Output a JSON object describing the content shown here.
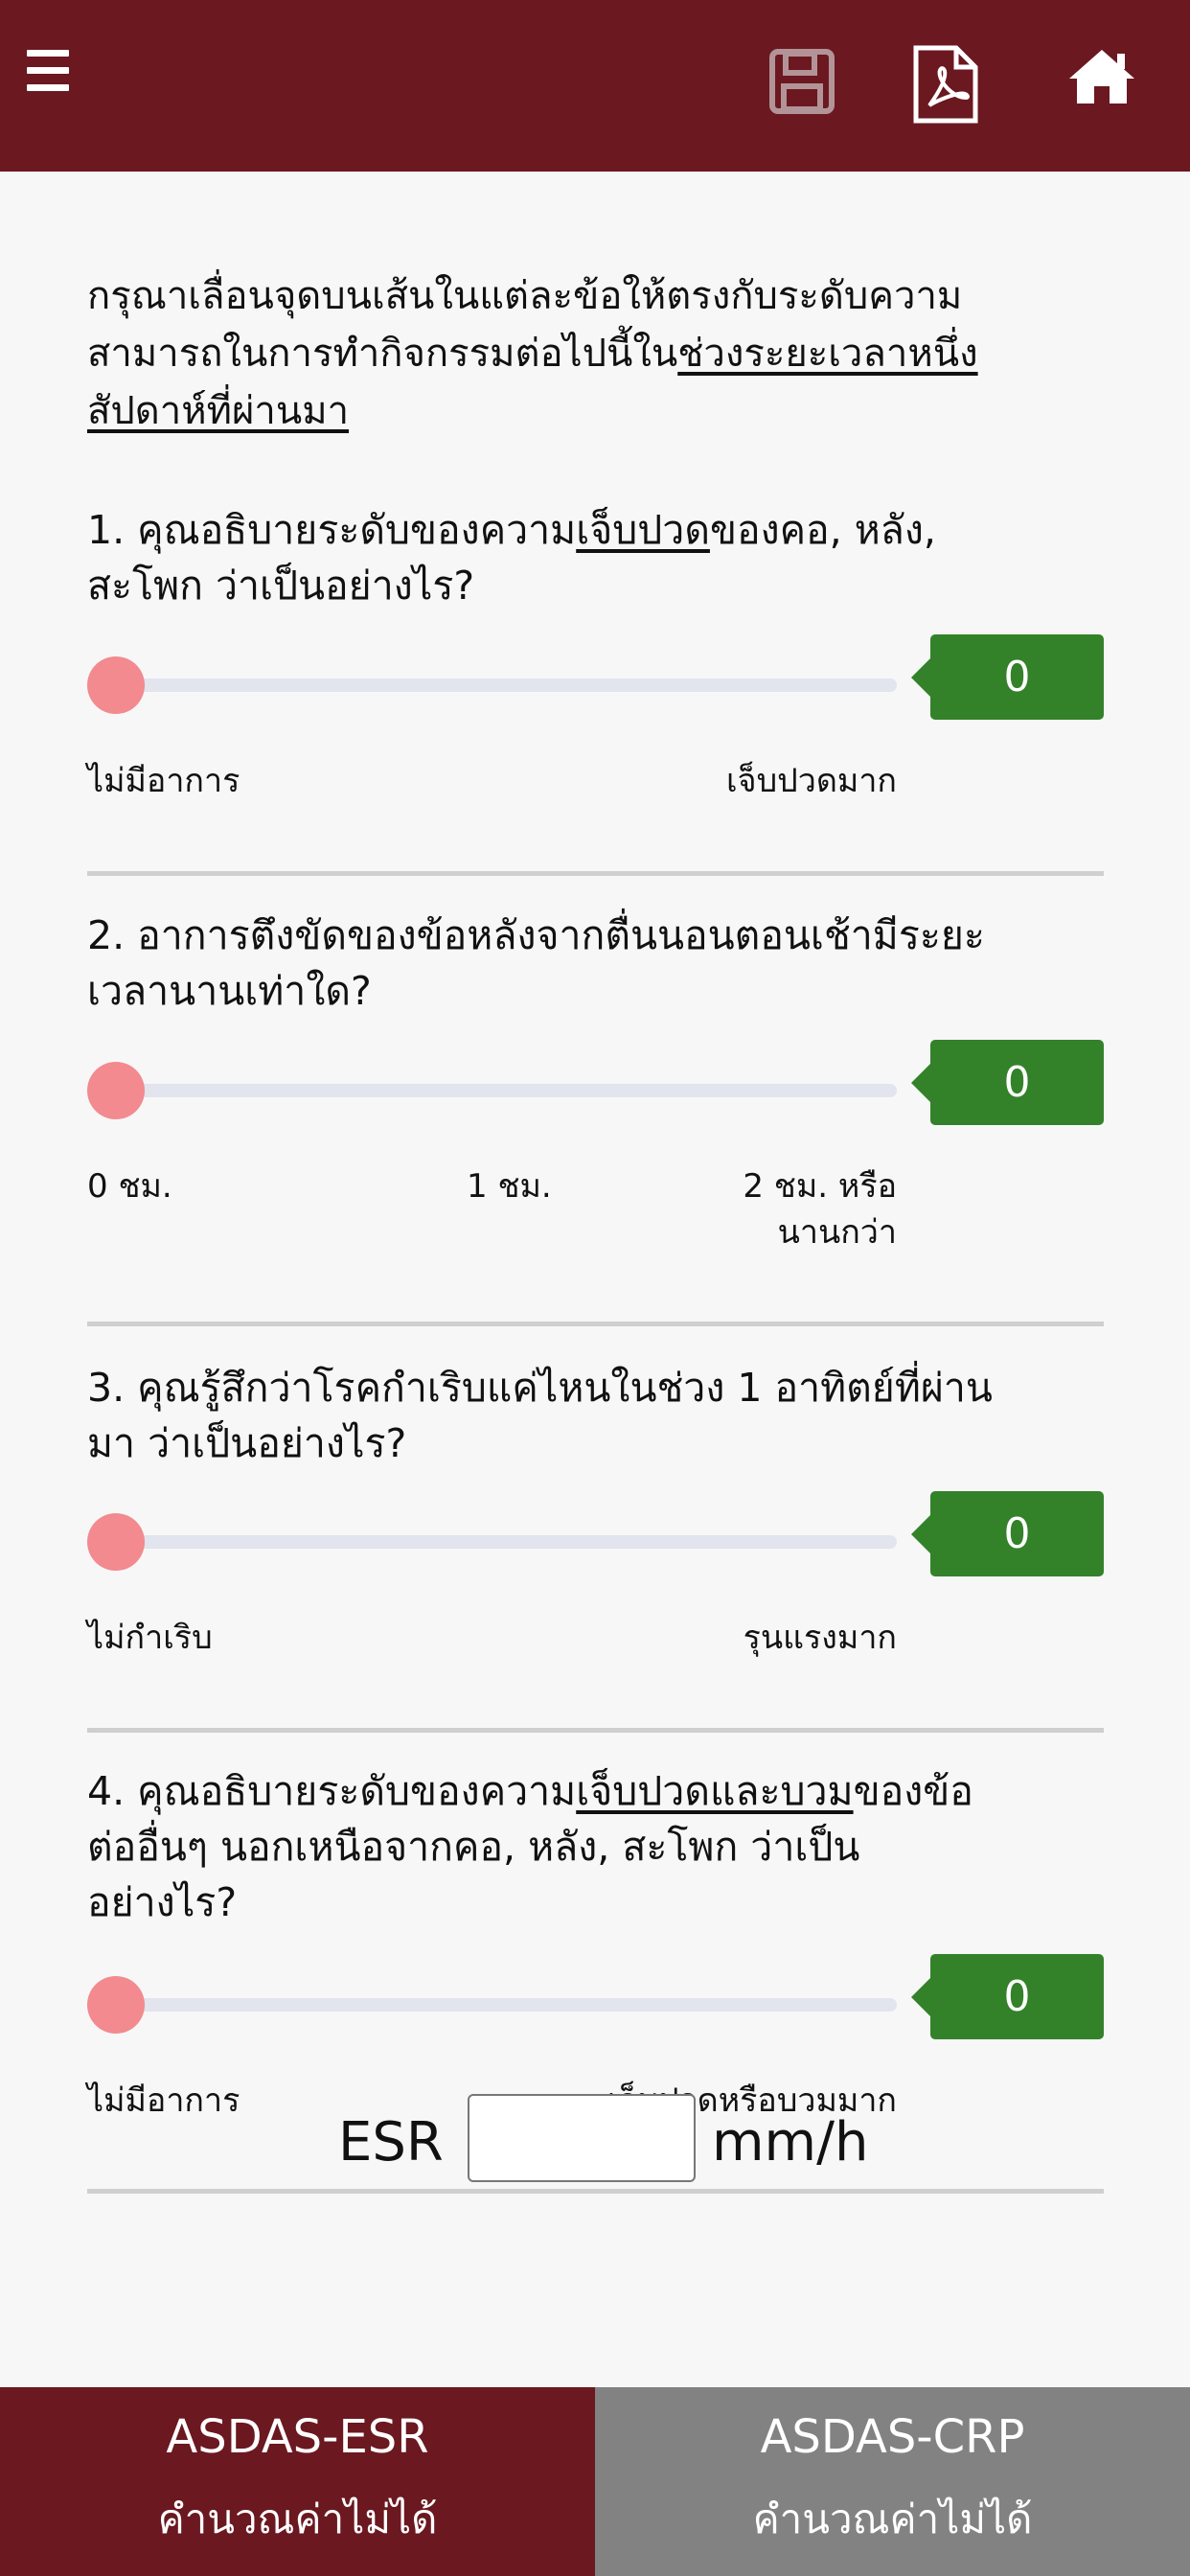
{
  "header": {
    "menu_icon": "hamburger-menu-icon",
    "save_icon": "floppy-disk-save-icon",
    "pdf_icon": "pdf-document-icon",
    "home_icon": "home-icon",
    "bar_color": "#6b1820"
  },
  "intro": {
    "line1": "กรุณาเลื่อนจุดบนเส้นในแต่ละข้อให้ตรงกับระดับความ",
    "line2_plain": "สามารถในการทำกิจกรรมต่อไปนี้ใน",
    "line2_underlined": "ช่วงระยะเวลาหนึ่ง",
    "line3_underlined": "สัปดาห์ที่ผ่านมา"
  },
  "questions": [
    {
      "q1_a": "1. คุณอธิบายระดับของความ",
      "q1_u": "เจ็บปวด",
      "q1_b": "ของคอ, หลัง,",
      "q1_line2": "สะโพก ว่าเป็นอย่างไร?",
      "value": "0",
      "tick_left": "ไม่มีอาการ",
      "tick_right": "เจ็บปวดมาก"
    },
    {
      "line1": "2. อาการตึงขัดของข้อหลังจากตื่นนอนตอนเช้ามีระยะ",
      "line2": "เวลานานเท่าใด?",
      "value": "0",
      "tick_left": "0 ชม.",
      "tick_mid": "1 ชม.",
      "tick_right_1": "2 ชม. หรือ",
      "tick_right_2": "นานกว่า"
    },
    {
      "line1": "3. คุณรู้สึกว่าโรคกำเริบแค่ไหนในช่วง 1 อาทิตย์ที่ผ่าน",
      "line2": "มา ว่าเป็นอย่างไร?",
      "value": "0",
      "tick_left": "ไม่กำเริบ",
      "tick_right": "รุนแรงมาก"
    },
    {
      "q4_a": "4. คุณอธิบายระดับของความ",
      "q4_u": "เจ็บปวดและบวม",
      "q4_b": "ของข้อ",
      "q4_line2": "ต่ออื่นๆ นอกเหนือจากคอ, หลัง, สะโพก ว่าเป็น",
      "q4_line3": "อย่างไร?",
      "value": "0",
      "tick_left": "ไม่มีอาการ",
      "tick_right": "เจ็บปวดหรือบวมมาก"
    }
  ],
  "esr": {
    "label": "ESR",
    "value": "",
    "unit": "mm/h"
  },
  "results": {
    "esr_name": "ASDAS-ESR",
    "esr_value": "คำนวณค่าไม่ได้",
    "crp_name": "ASDAS-CRP",
    "crp_value": "คำนวณค่าไม่ได้"
  },
  "colors": {
    "accent": "#6b1820",
    "badge": "#338229",
    "thumb": "#f28a8f",
    "inactive": "#828282"
  }
}
